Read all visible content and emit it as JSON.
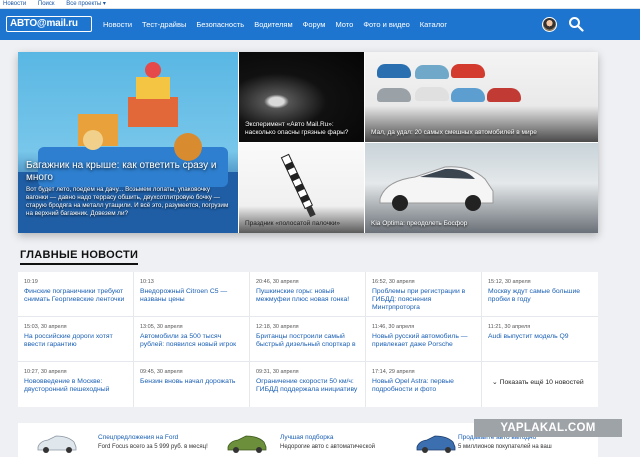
{
  "topbar": {
    "links": [
      "Новости",
      "Поиск",
      "Все проекты ▾"
    ]
  },
  "header": {
    "logo": "АВТО@mail.ru",
    "nav": [
      "Новости",
      "Тест-драйвы",
      "Безопасность",
      "Водителям",
      "Форум",
      "Мото",
      "Фото и видео",
      "Каталог"
    ]
  },
  "hero": {
    "main_title": "Багажник на крыше: как ответить сразу и много",
    "main_text": "Вот будет лето, поедем на дачу... Возьмем лопаты, упаковочку вагонки — давно надо террасу обшить, двухсотлитровую бочку — старую бродяга на металл утащили. И всё это, разумеется, погрузим на верхний багажник. Довезем ли?",
    "tile2_caption": "Эксперимент «Авто Mail.Ru»: насколько опасны грязные фары?",
    "tile3_caption": "Мал, да удал: 20 самых смешных автомобилей в мире",
    "tile4_caption": "Праздник «полосатой палочки»",
    "tile5_caption": "Kia Optima: преодолеть Босфор"
  },
  "news": {
    "section_title": "ГЛАВНЫЕ НОВОСТИ",
    "items": [
      {
        "time": "10:19",
        "title": "Финские пограничники требуют снимать Георгиевские ленточки"
      },
      {
        "time": "10:13",
        "title": "Внедорожный Citroen C5 — названы цены"
      },
      {
        "time": "20:46, 30 апреля",
        "title": "Пушкинские горы: новый межмуфеи плюс новая гонка!"
      },
      {
        "time": "16:52, 30 апреля",
        "title": "Проблемы при регистрации в ГИБДД: пояснения Минтрпроторга"
      },
      {
        "time": "15:12, 30 апреля",
        "title": "Москву ждут самые большие пробки в году"
      },
      {
        "time": "15:03, 30 апреля",
        "title": "На российские дороги хотят ввести гарантию"
      },
      {
        "time": "13:05, 30 апреля",
        "title": "Автомобили за 500 тысяч рублей: появился новый игрок"
      },
      {
        "time": "12:18, 30 апреля",
        "title": "Британцы построили самый быстрый дизельный спорткар в"
      },
      {
        "time": "11:46, 30 апреля",
        "title": "Новый русский автомобиль — привлекает даже Porsche"
      },
      {
        "time": "11:21, 30 апреля",
        "title": "Audi выпустит модель Q9"
      },
      {
        "time": "10:27, 30 апреля",
        "title": "Нововведение в Москве: двусторонний пешеходный"
      },
      {
        "time": "09:45, 30 апреля",
        "title": "Бензин вновь начал дорожать"
      },
      {
        "time": "09:31, 30 апреля",
        "title": "Ограничение скорости 50 км/ч: ГИБДД поддержала инициативу"
      },
      {
        "time": "17:14, 29 апреля",
        "title": "Новый Opel Astra: первые подробности и фото"
      }
    ],
    "more_label": "⌄ Показать ещё 10 новостей"
  },
  "promos": [
    {
      "title": "Спецпредложения на Ford",
      "text": "Ford Focus всего за 5 999 руб. в месяц!"
    },
    {
      "title": "Лучшая подборка",
      "text": "Недорогие авто с автоматической"
    },
    {
      "title": "Продавайте авто выгодно",
      "text": "5 миллионов покупателей на ваш"
    }
  ],
  "watermark": "YAPLAKAL.COM"
}
